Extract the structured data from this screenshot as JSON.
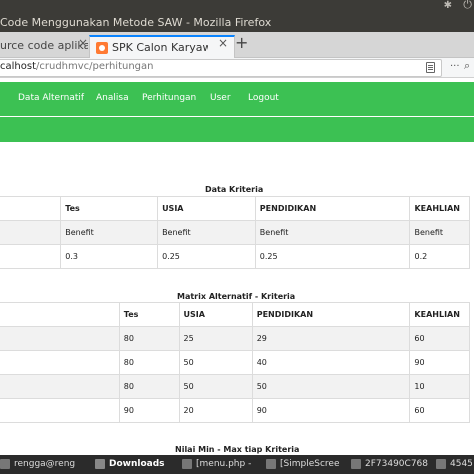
{
  "window": {
    "title": "Code Menggunakan Metode SAW - Mozilla Firefox"
  },
  "tabs": [
    {
      "label": "urce code aplikasi"
    },
    {
      "label": "SPK Calon Karyawan Pad"
    }
  ],
  "browser": {
    "url_host": "calhost",
    "url_path": "/crudhmvc/perhitungan"
  },
  "nav": {
    "items": [
      "Data Alternatif",
      "Analisa",
      "Perhitungan",
      "User",
      "Logout"
    ]
  },
  "kriteria": {
    "title": "Data Kriteria",
    "headers": [
      "",
      "Tes",
      "USIA",
      "PENDIDIKAN",
      "KEAHLIAN"
    ],
    "rows": [
      [
        "",
        "Benefit",
        "Benefit",
        "Benefit",
        "Benefit"
      ],
      [
        "",
        "0.3",
        "0.25",
        "0.25",
        "0.2"
      ]
    ]
  },
  "matrix": {
    "title": "Matrix Alternatif - Kriteria",
    "headers": [
      "",
      "Tes",
      "USIA",
      "PENDIDIKAN",
      "KEAHLIAN"
    ],
    "rows": [
      [
        "",
        "80",
        "25",
        "29",
        "60"
      ],
      [
        "",
        "80",
        "50",
        "40",
        "90"
      ],
      [
        "",
        "80",
        "50",
        "50",
        "10"
      ],
      [
        "",
        "90",
        "20",
        "90",
        "60"
      ]
    ]
  },
  "minmax": {
    "title": "Nilai Min - Max tiap Kriteria"
  },
  "taskbar": {
    "items": [
      "rengga@reng",
      "Downloads",
      "[menu.php -",
      "[SimpleScree",
      "2F73490C768",
      "4545"
    ]
  },
  "colors": {
    "accent_green": "#3cc153",
    "titlebar": "#3c3b37",
    "taskbar": "#2b2b2b"
  }
}
